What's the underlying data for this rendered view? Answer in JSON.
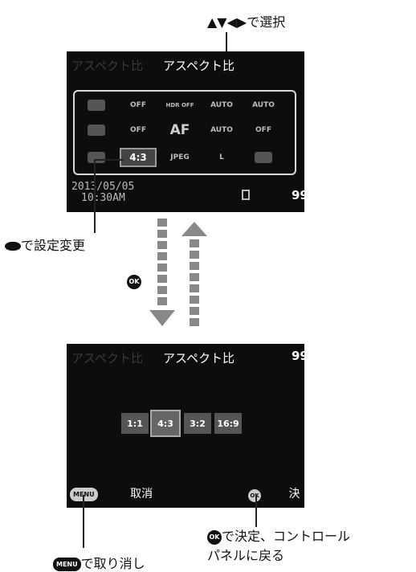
{
  "top_instruction": "▲▼◀▶で選択",
  "panel1": {
    "ghost_title": "アスペクト比",
    "title": "アスペクト比",
    "cells": [
      [
        "",
        "OFF",
        "HDR OFF",
        "AUTO",
        "AUTO"
      ],
      [
        "",
        "OFF",
        "AF",
        "AUTO",
        "OFF"
      ],
      [
        "",
        "4:3",
        "JPEG",
        "L",
        ""
      ]
    ],
    "date": "2013/05/05",
    "time": "10:30AM",
    "shots": "99"
  },
  "dial_label": "で設定変更",
  "ok_key": "OK",
  "panel2": {
    "ghost_title": "アスペクト比",
    "title": "アスペクト比",
    "shots": "99",
    "ratios": [
      "1:1",
      "4:3",
      "3:2",
      "16:9"
    ],
    "selected_ratio": "4:3",
    "menu_key": "MENU",
    "cancel": "取消",
    "ok_key": "OK",
    "confirm_partial": "決"
  },
  "ok_caption_line1": "で決定、コントロール",
  "ok_caption_line2": "パネルに戻る",
  "menu_caption": "で取り消し"
}
